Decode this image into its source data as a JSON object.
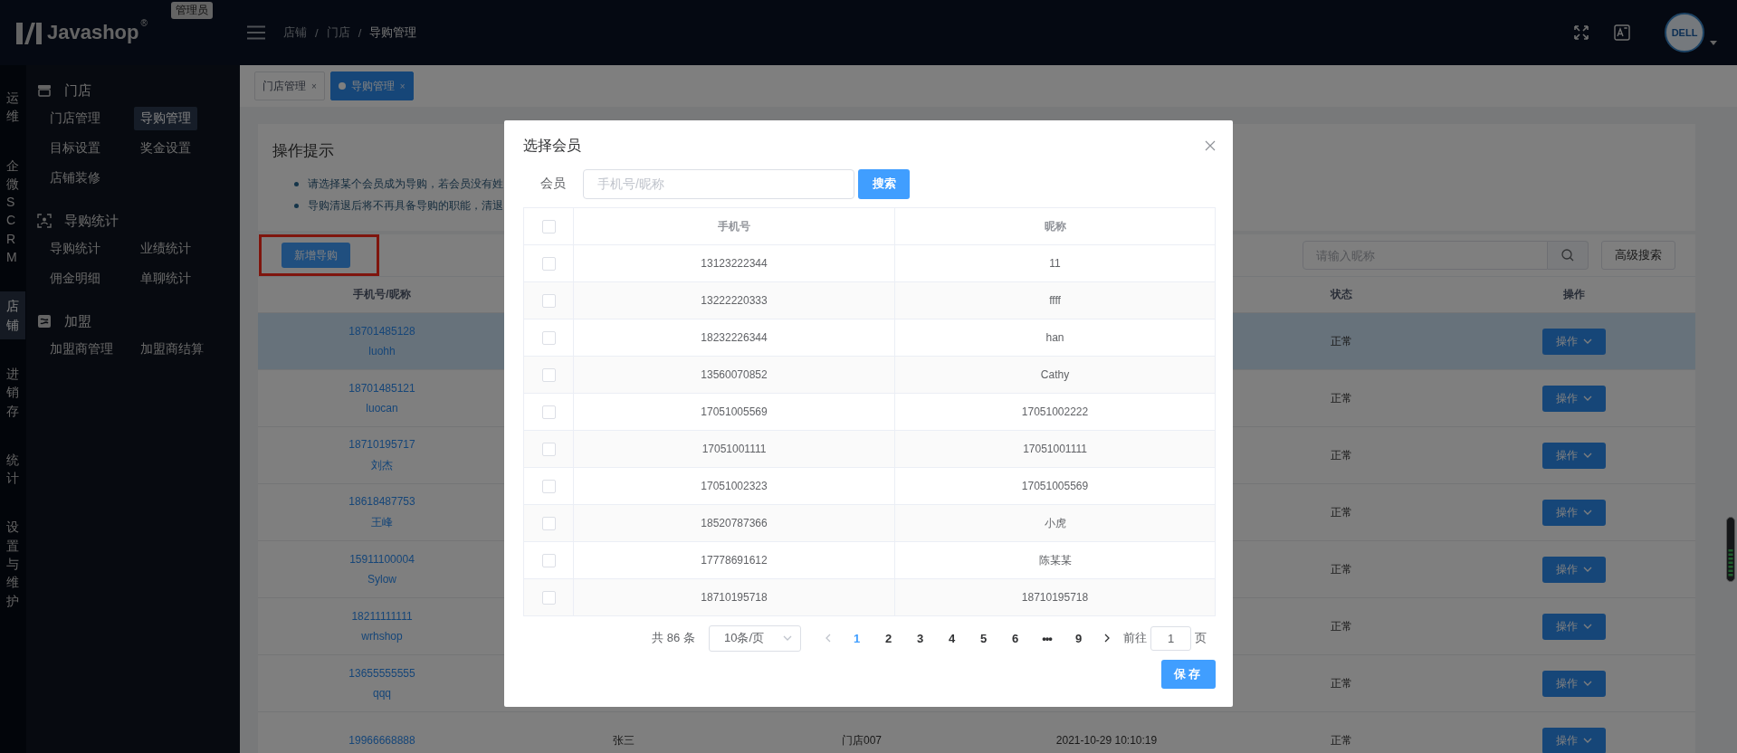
{
  "header": {
    "logo": "Javashop",
    "logo_mark": "®",
    "role_badge": "管理员",
    "breadcrumb": [
      {
        "label": "店铺",
        "current": false
      },
      {
        "label": "门店",
        "current": false
      },
      {
        "label": "导购管理",
        "current": true
      }
    ],
    "breadcrumb_separator": "/",
    "avatar_text": "DELL"
  },
  "rail": [
    {
      "label": "运维",
      "selected": false
    },
    {
      "label": "企微SCRM",
      "selected": false
    },
    {
      "label": "店铺",
      "selected": true
    },
    {
      "label": "进销存",
      "selected": false
    },
    {
      "label": "统计",
      "selected": false
    },
    {
      "label": "设置与维护",
      "selected": false
    }
  ],
  "sidebar": [
    {
      "title": "门店",
      "items": [
        {
          "label": "门店管理",
          "selected": false
        },
        {
          "label": "导购管理",
          "selected": true
        },
        {
          "label": "目标设置",
          "selected": false
        },
        {
          "label": "奖金设置",
          "selected": false
        },
        {
          "label": "店铺装修",
          "selected": false
        }
      ]
    },
    {
      "title": "导购统计",
      "items": [
        {
          "label": "导购统计",
          "selected": false
        },
        {
          "label": "业绩统计",
          "selected": false
        },
        {
          "label": "佣金明细",
          "selected": false
        },
        {
          "label": "单聊统计",
          "selected": false
        }
      ]
    },
    {
      "title": "加盟",
      "items": [
        {
          "label": "加盟商管理",
          "selected": false
        },
        {
          "label": "加盟商结算",
          "selected": false
        }
      ]
    }
  ],
  "tabs": [
    {
      "label": "门店管理",
      "selected": false,
      "close": "×"
    },
    {
      "label": "导购管理",
      "selected": true,
      "close": "×"
    }
  ],
  "tips": {
    "title": "操作提示",
    "items": [
      "请选择某个会员成为导购，若会员没有姓",
      "导购清退后将不再具备导购的职能，清退"
    ]
  },
  "toolbar": {
    "add_button": "新增导购",
    "add_highlighted": true,
    "search_placeholder": "请输入昵称",
    "advanced_button": "高级搜索"
  },
  "table": {
    "columns": [
      "手机号/昵称",
      "状态",
      "操作"
    ],
    "rows": [
      {
        "phone": "18701485128",
        "name": "luohh",
        "status": "正常",
        "action": "操作",
        "highlighted": true
      },
      {
        "phone": "18701485121",
        "name": "luocan",
        "status": "正常",
        "action": "操作",
        "highlighted": false
      },
      {
        "phone": "18710195717",
        "name": "刘杰",
        "status": "正常",
        "action": "操作",
        "highlighted": false
      },
      {
        "phone": "18618487753",
        "name": "王峰",
        "status": "正常",
        "action": "操作",
        "highlighted": false
      },
      {
        "phone": "15911100004",
        "name": "Sylow",
        "status": "正常",
        "action": "操作",
        "highlighted": false
      },
      {
        "phone": "18211111111",
        "name": "wrhshop",
        "status": "正常",
        "action": "操作",
        "highlighted": false
      },
      {
        "phone": "13655555555",
        "name": "qqq",
        "status": "正常",
        "action": "操作",
        "highlighted": false
      },
      {
        "phone": "19966668888",
        "column_2": "张三",
        "column_3": "门店007",
        "column_4": "2021-10-29 10:10:19",
        "status": "正常",
        "action": "操作",
        "highlighted": false
      }
    ]
  },
  "dialog": {
    "title": "选择会员",
    "field_label": "会员",
    "search_placeholder": "手机号/昵称",
    "search_button": "搜索",
    "columns": [
      "手机号",
      "昵称"
    ],
    "select_all_checked": false,
    "rows": [
      {
        "phone": "13123222344",
        "nickname": "11",
        "checked": false
      },
      {
        "phone": "13222220333",
        "nickname": "ffff",
        "checked": false
      },
      {
        "phone": "18232226344",
        "nickname": "han",
        "checked": false
      },
      {
        "phone": "13560070852",
        "nickname": "Cathy",
        "checked": false
      },
      {
        "phone": "17051005569",
        "nickname": "17051002222",
        "checked": false
      },
      {
        "phone": "17051001111",
        "nickname": "17051001111",
        "checked": false
      },
      {
        "phone": "17051002323",
        "nickname": "17051005569",
        "checked": false
      },
      {
        "phone": "18520787366",
        "nickname": "小虎",
        "checked": false
      },
      {
        "phone": "17778691612",
        "nickname": "陈某某",
        "checked": false
      },
      {
        "phone": "18710195718",
        "nickname": "18710195718",
        "checked": false
      }
    ],
    "pagination": {
      "total": "共 86 条",
      "page_size": "10条/页",
      "pages": [
        {
          "label": "1",
          "kind": "page",
          "selected": true
        },
        {
          "label": "2",
          "kind": "page",
          "selected": false
        },
        {
          "label": "3",
          "kind": "page",
          "selected": false
        },
        {
          "label": "4",
          "kind": "page",
          "selected": false
        },
        {
          "label": "5",
          "kind": "page",
          "selected": false
        },
        {
          "label": "6",
          "kind": "page",
          "selected": false
        },
        {
          "label": "•••",
          "kind": "ellipsis",
          "selected": false
        },
        {
          "label": "9",
          "kind": "page",
          "selected": false
        }
      ],
      "goto_label": "前往",
      "goto_value": "1",
      "goto_suffix": "页"
    },
    "save_button": "保存"
  }
}
